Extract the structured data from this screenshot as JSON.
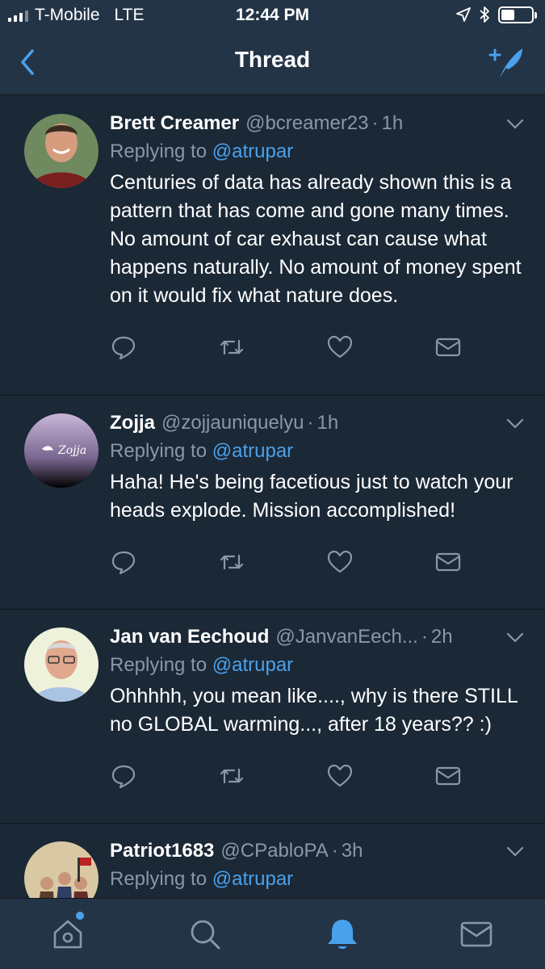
{
  "status_bar": {
    "carrier": "T-Mobile",
    "network": "LTE",
    "time": "12:44 PM",
    "battery_level": 0.45
  },
  "nav": {
    "title": "Thread",
    "back_icon": "chevron-left-icon",
    "compose_icon": "compose-tweet-icon"
  },
  "tweets": [
    {
      "name": "Brett Creamer",
      "handle": "@bcreamer23",
      "separator": "·",
      "time": "1h",
      "replying_prefix": "Replying to",
      "replying_to": "@atrupar",
      "text": "Centuries of data has already shown this is a pattern that has come and gone many times.  No amount of car exhaust can cause what happens naturally.  No amount of money spent on it would fix what nature does."
    },
    {
      "name": "Zojja",
      "handle": "@zojjauniquelyu",
      "separator": "·",
      "time": "1h",
      "replying_prefix": "Replying to",
      "replying_to": "@atrupar",
      "text": "Haha! He's being facetious just to watch your heads explode. Mission accomplished!"
    },
    {
      "name": "Jan van Eechoud",
      "handle": "@JanvanEech...",
      "separator": "·",
      "time": "2h",
      "replying_prefix": "Replying to",
      "replying_to": "@atrupar",
      "text": "Ohhhhh, you mean like...., why is there STILL no GLOBAL warming..., after 18 years?? :)"
    },
    {
      "name": "Patriot1683",
      "handle": "@CPabloPA",
      "separator": "·",
      "time": "3h",
      "replying_prefix": "Replying to",
      "replying_to": "@atrupar",
      "text": ""
    }
  ],
  "colors": {
    "background": "#1b2836",
    "bar": "#243447",
    "accent": "#4aa1eb",
    "muted": "#8899a6"
  },
  "tab_bar": {
    "items": [
      "home-icon",
      "search-icon",
      "notifications-bell-icon",
      "messages-envelope-icon"
    ],
    "active": "notifications-bell-icon"
  }
}
